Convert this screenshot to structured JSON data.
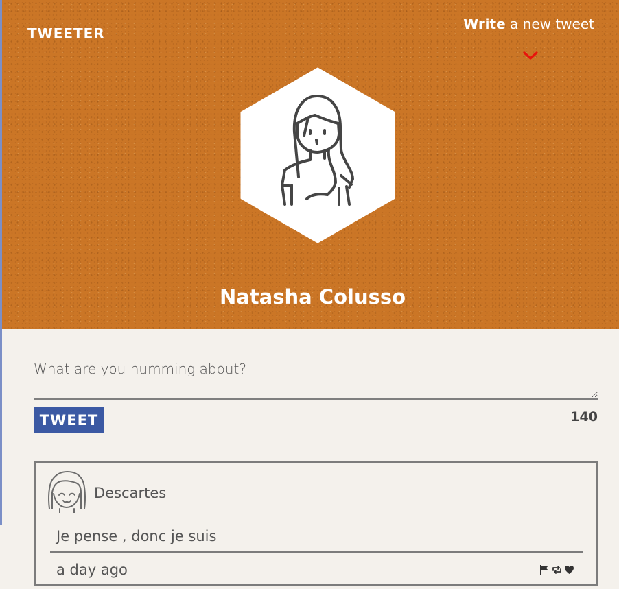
{
  "header": {
    "logo": "TWEETER",
    "write_bold": "Write",
    "write_rest": "a new tweet",
    "profile_name": "Natasha Colusso",
    "accent_color": "#cb7626"
  },
  "compose": {
    "placeholder": "What are you humming about?",
    "button_label": "TWEET",
    "char_count": "140",
    "button_color": "#3b59a3"
  },
  "tweets": [
    {
      "author": "Descartes",
      "text": "Je pense , donc je suis",
      "time": "a day ago",
      "icons": [
        "flag-icon",
        "retweet-icon",
        "heart-icon"
      ]
    }
  ]
}
